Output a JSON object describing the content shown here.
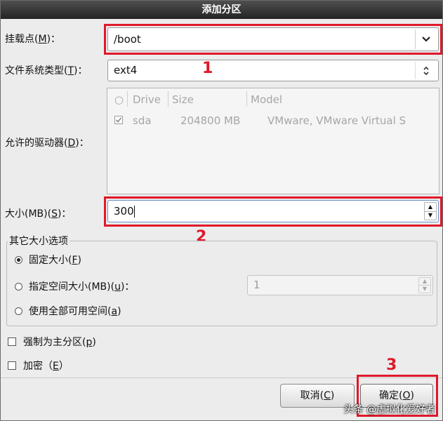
{
  "dialog": {
    "title": "添加分区"
  },
  "mount_point": {
    "label_pre": "挂载点(",
    "label_key": "M",
    "label_post": ")：",
    "value": "/boot"
  },
  "fs_type": {
    "label_pre": "文件系统类型(",
    "label_key": "T",
    "label_post": ")：",
    "value": "ext4"
  },
  "drives": {
    "label_pre": "允许的驱动器(",
    "label_key": "D",
    "label_post": ")：",
    "columns": {
      "select": "○",
      "drive": "Drive",
      "size": "Size",
      "model": "Model"
    },
    "rows": [
      {
        "checked": true,
        "drive": "sda",
        "size": "204800 MB",
        "model": "VMware, VMware Virtual S"
      }
    ]
  },
  "size": {
    "label_pre": "大小(MB)(",
    "label_key": "S",
    "label_post": ")：",
    "value": "300"
  },
  "size_options": {
    "legend": "其它大小选项",
    "fixed": {
      "pre": "固定大小(",
      "key": "F",
      "post": ")",
      "selected": true
    },
    "upto": {
      "pre": "指定空间大小(MB)(",
      "key": "u",
      "post": ")：",
      "value": "1",
      "selected": false
    },
    "fill": {
      "pre": "使用全部可用空间(",
      "key": "a",
      "post": ")",
      "selected": false
    }
  },
  "primary": {
    "pre": "强制为主分区(",
    "key": "p",
    "post": ")",
    "checked": false
  },
  "encrypt": {
    "pre": "加密（",
    "key": "E",
    "post": "）",
    "checked": false
  },
  "buttons": {
    "cancel": {
      "pre": "取消(",
      "key": "C",
      "post": ")"
    },
    "ok": {
      "pre": "确定(",
      "key": "O",
      "post": ")"
    }
  },
  "annotations": [
    "1",
    "2",
    "3"
  ],
  "watermark": "头条 @虚拟化爱好者",
  "colors": {
    "annotation": "#e0182a",
    "titlebar": "#2f2f2f",
    "dialog_bg": "#ececec"
  }
}
